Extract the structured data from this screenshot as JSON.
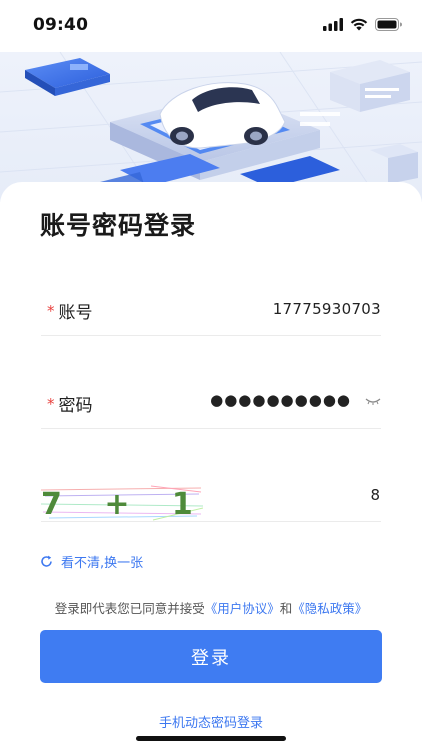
{
  "status_bar": {
    "time": "09:40",
    "icons": [
      "signal-icon",
      "wifi-icon",
      "battery-icon"
    ]
  },
  "hero": {
    "illustration": "car-illustration"
  },
  "page_title": "账号密码登录",
  "account": {
    "required_mark": "*",
    "label": "账号",
    "value": "17775930703"
  },
  "password": {
    "required_mark": "*",
    "label": "密码",
    "value_masked": "●●●●●●●●●●",
    "toggle_icon": "eye-closed-icon"
  },
  "captcha": {
    "image_text": "7 + 1 =",
    "answer": "8"
  },
  "refresh": {
    "icon": "refresh-icon",
    "label": "看不清,换一张"
  },
  "agreement": {
    "prefix": "登录即代表您已同意并接受",
    "user_agreement": "《用户协议》",
    "conjunction": "和",
    "privacy_policy": "《隐私政策》"
  },
  "login_button": "登录",
  "alt_login": "手机动态密码登录",
  "colors": {
    "accent": "#3f7cf2",
    "link": "#3d78f0",
    "required": "#e8423f"
  }
}
